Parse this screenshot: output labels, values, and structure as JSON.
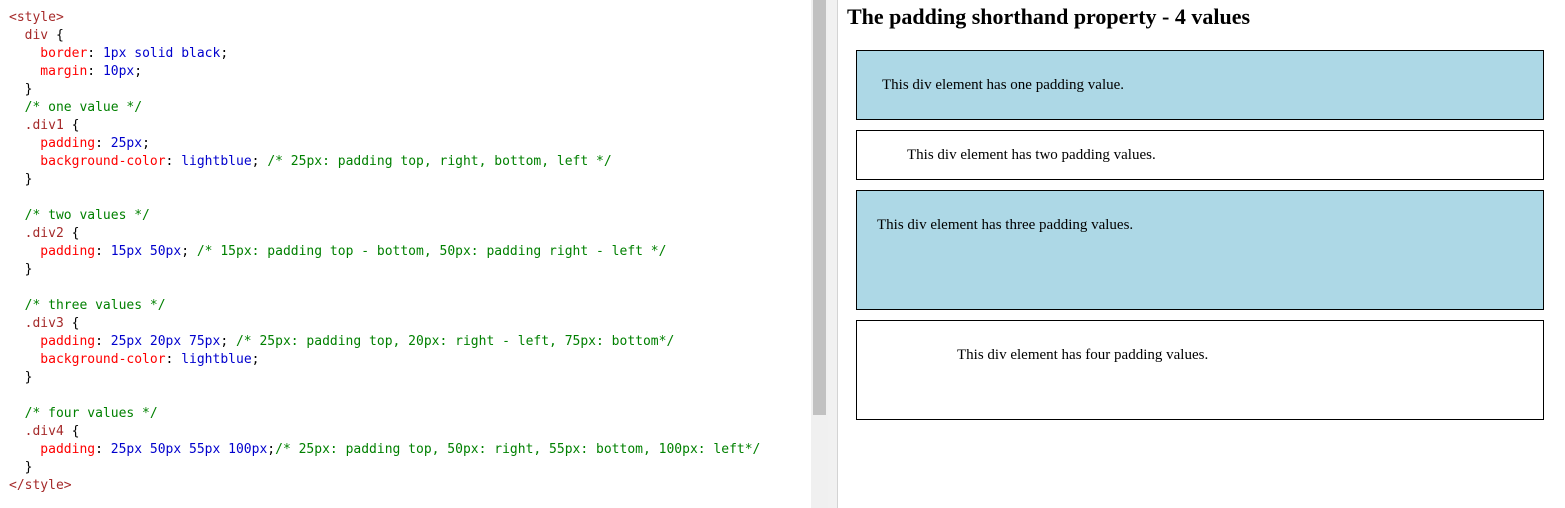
{
  "editor": {
    "lines": [
      [
        {
          "c": "tag",
          "t": "<style>"
        }
      ],
      [
        {
          "c": "sel",
          "t": "  div "
        },
        {
          "c": "pun",
          "t": "{"
        }
      ],
      [
        {
          "c": "prop",
          "t": "    border"
        },
        {
          "c": "pun",
          "t": ": "
        },
        {
          "c": "val",
          "t": "1px solid black"
        },
        {
          "c": "pun",
          "t": ";"
        }
      ],
      [
        {
          "c": "prop",
          "t": "    margin"
        },
        {
          "c": "pun",
          "t": ": "
        },
        {
          "c": "val",
          "t": "10px"
        },
        {
          "c": "pun",
          "t": ";"
        }
      ],
      [
        {
          "c": "pun",
          "t": "  }"
        }
      ],
      [
        {
          "c": "com",
          "t": "  /* one value */"
        }
      ],
      [
        {
          "c": "sel",
          "t": "  .div1 "
        },
        {
          "c": "pun",
          "t": "{"
        }
      ],
      [
        {
          "c": "prop",
          "t": "    padding"
        },
        {
          "c": "pun",
          "t": ": "
        },
        {
          "c": "val",
          "t": "25px"
        },
        {
          "c": "pun",
          "t": ";"
        }
      ],
      [
        {
          "c": "prop",
          "t": "    background-color"
        },
        {
          "c": "pun",
          "t": ": "
        },
        {
          "c": "val",
          "t": "lightblue"
        },
        {
          "c": "pun",
          "t": "; "
        },
        {
          "c": "com",
          "t": "/* 25px: padding top, right, bottom, left */"
        }
      ],
      [
        {
          "c": "pun",
          "t": "  }"
        }
      ],
      [
        {
          "c": "pun",
          "t": ""
        }
      ],
      [
        {
          "c": "com",
          "t": "  /* two values */"
        }
      ],
      [
        {
          "c": "sel",
          "t": "  .div2 "
        },
        {
          "c": "pun",
          "t": "{"
        }
      ],
      [
        {
          "c": "prop",
          "t": "    padding"
        },
        {
          "c": "pun",
          "t": ": "
        },
        {
          "c": "val",
          "t": "15px 50px"
        },
        {
          "c": "pun",
          "t": "; "
        },
        {
          "c": "com",
          "t": "/* 15px: padding top - bottom, 50px: padding right - left */"
        }
      ],
      [
        {
          "c": "pun",
          "t": "  }"
        }
      ],
      [
        {
          "c": "pun",
          "t": ""
        }
      ],
      [
        {
          "c": "com",
          "t": "  /* three values */"
        }
      ],
      [
        {
          "c": "sel",
          "t": "  .div3 "
        },
        {
          "c": "pun",
          "t": "{"
        }
      ],
      [
        {
          "c": "prop",
          "t": "    padding"
        },
        {
          "c": "pun",
          "t": ": "
        },
        {
          "c": "val",
          "t": "25px 20px 75px"
        },
        {
          "c": "pun",
          "t": "; "
        },
        {
          "c": "com",
          "t": "/* 25px: padding top, 20px: right - left, 75px: bottom*/"
        }
      ],
      [
        {
          "c": "prop",
          "t": "    background-color"
        },
        {
          "c": "pun",
          "t": ": "
        },
        {
          "c": "val",
          "t": "lightblue"
        },
        {
          "c": "pun",
          "t": ";"
        }
      ],
      [
        {
          "c": "pun",
          "t": "  }"
        }
      ],
      [
        {
          "c": "pun",
          "t": ""
        }
      ],
      [
        {
          "c": "com",
          "t": "  /* four values */"
        }
      ],
      [
        {
          "c": "sel",
          "t": "  .div4 "
        },
        {
          "c": "pun",
          "t": "{"
        }
      ],
      [
        {
          "c": "prop",
          "t": "    padding"
        },
        {
          "c": "pun",
          "t": ": "
        },
        {
          "c": "val",
          "t": "25px 50px 55px 100px"
        },
        {
          "c": "pun",
          "t": ";"
        },
        {
          "c": "com",
          "t": "/* 25px: padding top, 50px: right, 55px: bottom, 100px: left*/"
        }
      ],
      [
        {
          "c": "pun",
          "t": "  }"
        }
      ],
      [
        {
          "c": "tag",
          "t": "</style>"
        }
      ]
    ]
  },
  "result": {
    "heading": "The padding shorthand property - 4 values",
    "box1_text": "This div element has one padding value.",
    "box2_text": "This div element has two padding values.",
    "box3_text": "This div element has three padding values.",
    "box4_text": "This div element has four padding values."
  },
  "colors": {
    "lightblue": "#add8e6",
    "tag": "#a52a2a",
    "property": "#ff0000",
    "value": "#0000cd",
    "comment": "#008000"
  }
}
